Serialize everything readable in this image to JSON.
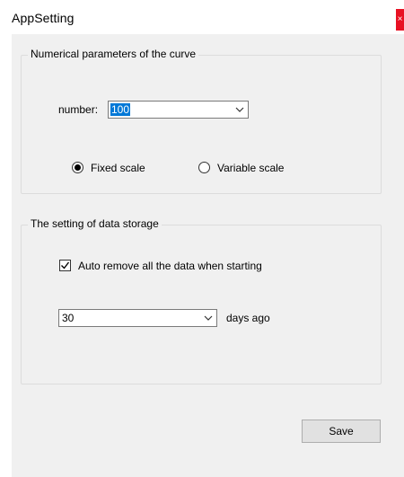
{
  "window": {
    "title": "AppSetting",
    "close_glyph": "×"
  },
  "curve_group": {
    "legend": "Numerical parameters of the curve",
    "number_label": "number:",
    "number_value": "100",
    "radio_fixed_label": "Fixed scale",
    "radio_variable_label": "Variable  scale",
    "selected_scale": "Fixed scale"
  },
  "storage_group": {
    "legend": "The setting of data  storage",
    "auto_remove_label": "Auto remove all the data when starting",
    "auto_remove_checked": true,
    "days_value": "30",
    "days_suffix": "days ago"
  },
  "actions": {
    "save_label": "Save"
  },
  "icons": {
    "close": "close-icon",
    "dropdown": "chevron-down-icon",
    "check": "checkmark-icon"
  }
}
